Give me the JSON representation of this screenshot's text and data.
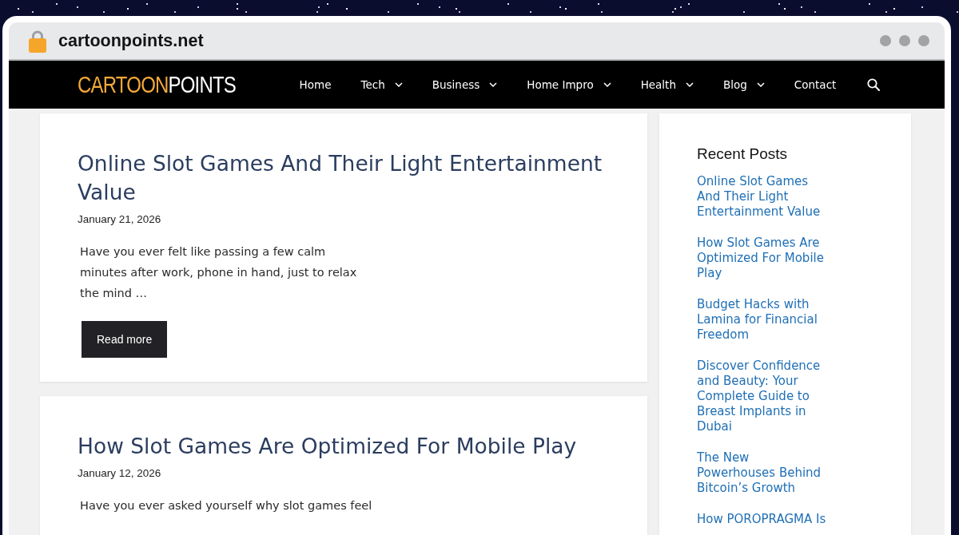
{
  "browser": {
    "url": "cartoonpoints.net"
  },
  "site": {
    "logo_accent": "CARTOON",
    "logo_main": "POINTS"
  },
  "nav": [
    {
      "label": "Home",
      "has_submenu": false
    },
    {
      "label": "Tech",
      "has_submenu": true
    },
    {
      "label": "Business",
      "has_submenu": true
    },
    {
      "label": "Home Impro",
      "has_submenu": true
    },
    {
      "label": "Health",
      "has_submenu": true
    },
    {
      "label": "Blog",
      "has_submenu": true
    },
    {
      "label": "Contact",
      "has_submenu": false
    }
  ],
  "posts": [
    {
      "title": "Online Slot Games And Their Light Entertainment Value",
      "date": "January 21, 2026",
      "excerpt": "Have you ever felt like passing a few calm minutes after work, phone in hand, just to relax the mind …",
      "button": "Read more"
    },
    {
      "title": "How Slot Games Are Optimized For Mobile Play",
      "date": "January 12, 2026",
      "excerpt": "Have you ever asked yourself why slot games feel"
    }
  ],
  "sidebar": {
    "heading": "Recent Posts",
    "links": [
      "Online Slot Games And Their Light Entertainment Value",
      "How Slot Games Are Optimized For Mobile Play",
      "Budget Hacks with Lamina for Financial Freedom",
      "Discover Confidence and Beauty: Your Complete Guide to Breast Implants in Dubai",
      "The New Powerhouses Behind Bitcoin’s Growth",
      "How POROPRAGMA Is"
    ]
  }
}
